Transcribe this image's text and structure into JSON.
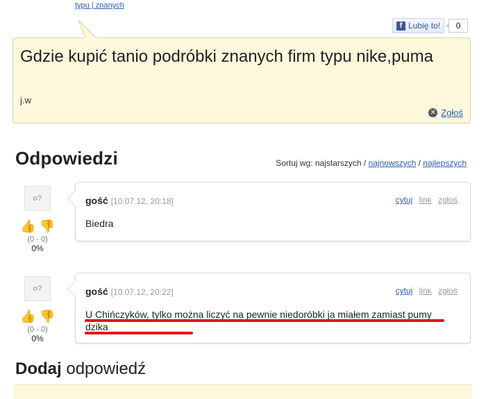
{
  "top": {
    "links": "typu | znanych"
  },
  "like": {
    "label": "Lubię to!",
    "count": "0",
    "icon": "facebook-icon"
  },
  "question": {
    "title": "Gdzie kupić tanio podróbki znanych firm typu nike,puma",
    "author": "j.w",
    "report_label": "Zgłoś"
  },
  "answers": {
    "title": "Odpowiedzi",
    "sort_prefix": "Sortuj wg: najstarszych / ",
    "sort_newest": "najnowszych",
    "sort_sep": " / ",
    "sort_best": "najlepszych"
  },
  "answer_list": [
    {
      "user": "gość",
      "date": "[10.07.12, 20:18]",
      "text": "Biedra",
      "score": "(0 - 0)",
      "percent": "0%",
      "actions": {
        "quote": "cytuj",
        "link": "link",
        "report": "zgłoś"
      }
    },
    {
      "user": "gość",
      "date": "[10.07.12, 20:22]",
      "text": "U Chińczyków, tylko można liczyć na pewnie niedoróbki ja miałem zamiast pumy dzika",
      "score": "(0 - 0)",
      "percent": "0%",
      "actions": {
        "quote": "cytuj",
        "link": "link",
        "report": "zgłoś"
      }
    }
  ],
  "add_reply": {
    "bold": "Dodaj",
    "rest": " odpowiedź"
  },
  "colors": {
    "accent_link": "#2a5db0",
    "question_bg": "#fdf8dc",
    "highlight": "#e3151a"
  }
}
